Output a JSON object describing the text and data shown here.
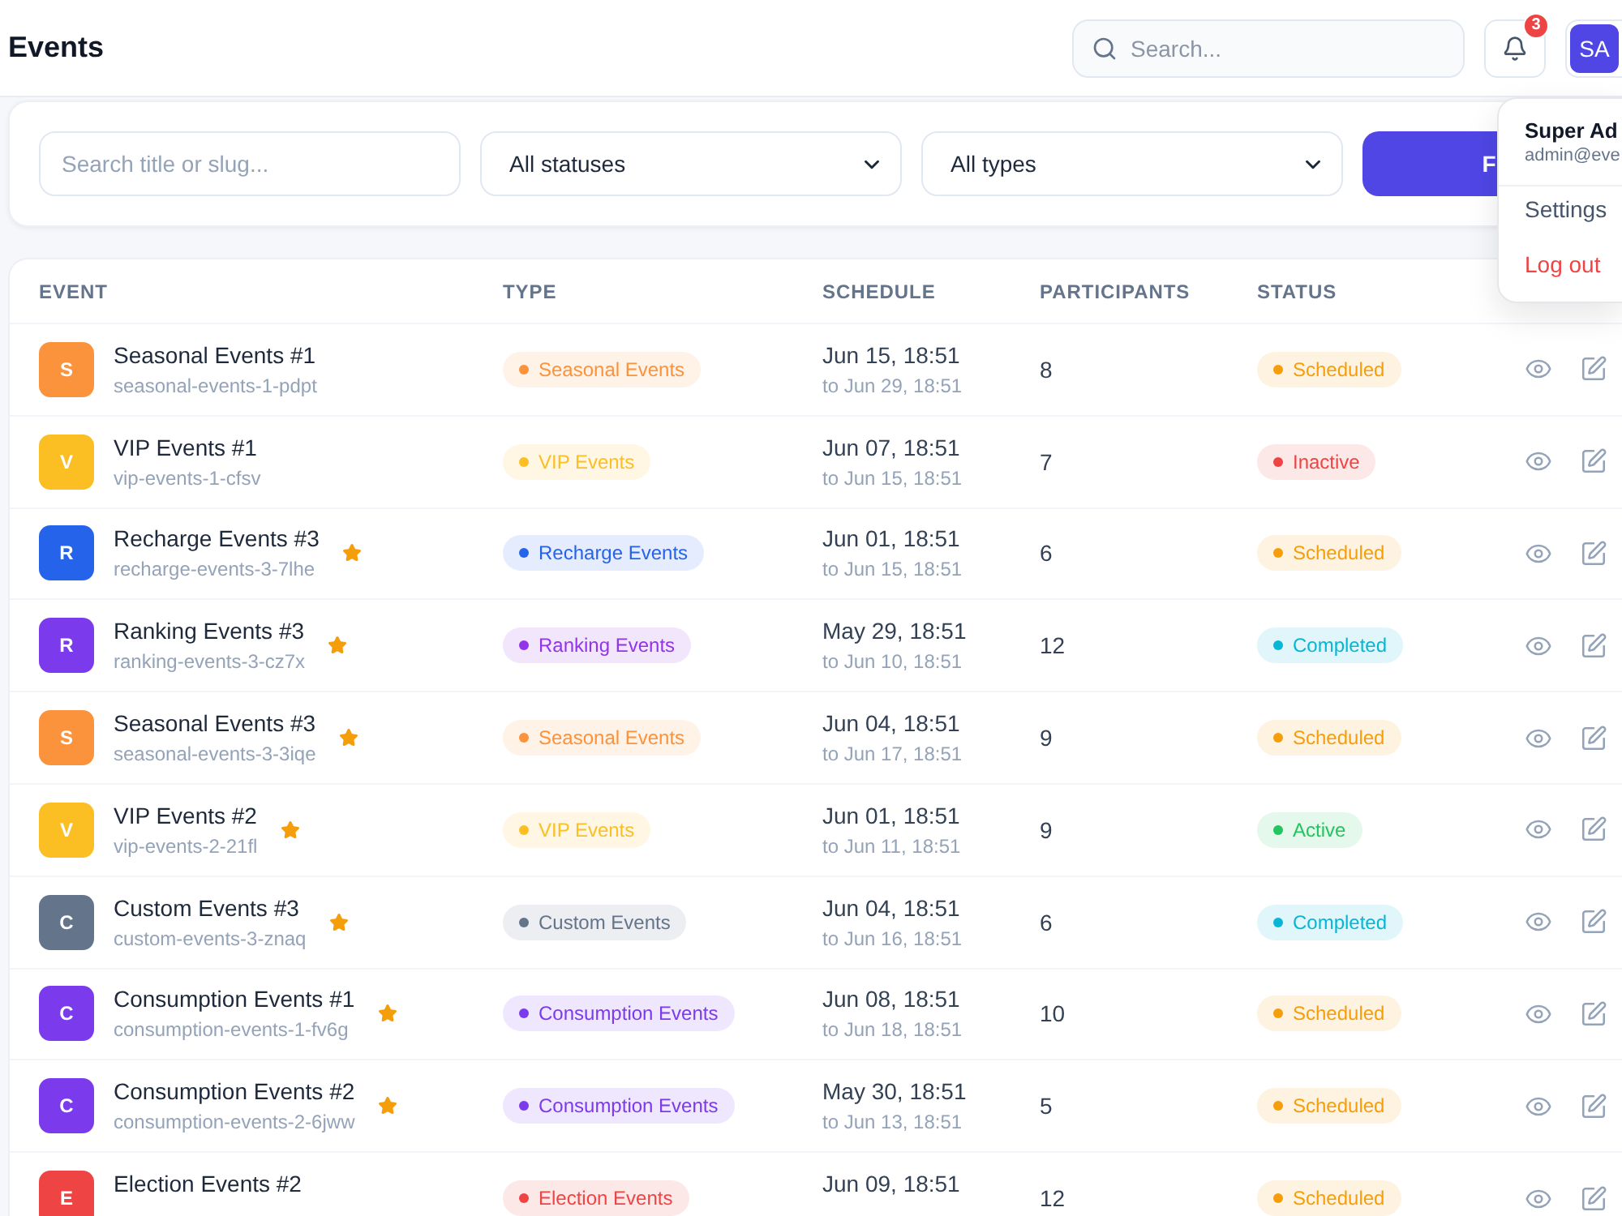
{
  "header": {
    "title": "Events",
    "search": {
      "placeholder": "Search..."
    },
    "notifications": {
      "count": "3"
    },
    "user": {
      "initials": "SA"
    }
  },
  "user_menu": {
    "name": "Super Ad",
    "email": "admin@eve",
    "items": [
      {
        "label": "Settings",
        "kind": "link"
      },
      {
        "label": "Log out",
        "kind": "danger"
      }
    ]
  },
  "filters": {
    "search": {
      "placeholder": "Search title or slug..."
    },
    "status_select": {
      "value": "All statuses"
    },
    "type_select": {
      "value": "All types"
    },
    "submit": {
      "label": "F"
    }
  },
  "table": {
    "columns": [
      "EVENT",
      "TYPE",
      "SCHEDULE",
      "PARTICIPANTS",
      "STATUS"
    ],
    "rows": [
      {
        "avatar": {
          "letter": "S",
          "color": "#fb923c"
        },
        "title": "Seasonal Events #1",
        "slug": "seasonal-events-1-pdpt",
        "featured": false,
        "type": {
          "label": "Seasonal Events",
          "color": "#fb923c"
        },
        "start": "Jun 15, 18:51",
        "end": "to Jun 29, 18:51",
        "participants": "8",
        "status": {
          "label": "Scheduled",
          "color": "#f59e0b"
        }
      },
      {
        "avatar": {
          "letter": "V",
          "color": "#fbbf24"
        },
        "title": "VIP Events #1",
        "slug": "vip-events-1-cfsv",
        "featured": false,
        "type": {
          "label": "VIP Events",
          "color": "#fbbf24"
        },
        "start": "Jun 07, 18:51",
        "end": "to Jun 15, 18:51",
        "participants": "7",
        "status": {
          "label": "Inactive",
          "color": "#ef4444"
        }
      },
      {
        "avatar": {
          "letter": "R",
          "color": "#2563eb"
        },
        "title": "Recharge Events #3",
        "slug": "recharge-events-3-7lhe",
        "featured": true,
        "type": {
          "label": "Recharge Events",
          "color": "#2563eb"
        },
        "start": "Jun 01, 18:51",
        "end": "to Jun 15, 18:51",
        "participants": "6",
        "status": {
          "label": "Scheduled",
          "color": "#f59e0b"
        }
      },
      {
        "avatar": {
          "letter": "R",
          "color": "#7c3aed"
        },
        "title": "Ranking Events #3",
        "slug": "ranking-events-3-cz7x",
        "featured": true,
        "type": {
          "label": "Ranking Events",
          "color": "#9333ea"
        },
        "start": "May 29, 18:51",
        "end": "to Jun 10, 18:51",
        "participants": "12",
        "status": {
          "label": "Completed",
          "color": "#06b6d4"
        }
      },
      {
        "avatar": {
          "letter": "S",
          "color": "#fb923c"
        },
        "title": "Seasonal Events #3",
        "slug": "seasonal-events-3-3iqe",
        "featured": true,
        "type": {
          "label": "Seasonal Events",
          "color": "#fb923c"
        },
        "start": "Jun 04, 18:51",
        "end": "to Jun 17, 18:51",
        "participants": "9",
        "status": {
          "label": "Scheduled",
          "color": "#f59e0b"
        }
      },
      {
        "avatar": {
          "letter": "V",
          "color": "#fbbf24"
        },
        "title": "VIP Events #2",
        "slug": "vip-events-2-21fl",
        "featured": true,
        "type": {
          "label": "VIP Events",
          "color": "#fbbf24"
        },
        "start": "Jun 01, 18:51",
        "end": "to Jun 11, 18:51",
        "participants": "9",
        "status": {
          "label": "Active",
          "color": "#22c55e"
        }
      },
      {
        "avatar": {
          "letter": "C",
          "color": "#64748b"
        },
        "title": "Custom Events #3",
        "slug": "custom-events-3-znaq",
        "featured": true,
        "type": {
          "label": "Custom Events",
          "color": "#64748b"
        },
        "start": "Jun 04, 18:51",
        "end": "to Jun 16, 18:51",
        "participants": "6",
        "status": {
          "label": "Completed",
          "color": "#06b6d4"
        }
      },
      {
        "avatar": {
          "letter": "C",
          "color": "#7c3aed"
        },
        "title": "Consumption Events #1",
        "slug": "consumption-events-1-fv6g",
        "featured": true,
        "type": {
          "label": "Consumption Events",
          "color": "#7c3aed"
        },
        "start": "Jun 08, 18:51",
        "end": "to Jun 18, 18:51",
        "participants": "10",
        "status": {
          "label": "Scheduled",
          "color": "#f59e0b"
        }
      },
      {
        "avatar": {
          "letter": "C",
          "color": "#7c3aed"
        },
        "title": "Consumption Events #2",
        "slug": "consumption-events-2-6jww",
        "featured": true,
        "type": {
          "label": "Consumption Events",
          "color": "#7c3aed"
        },
        "start": "May 30, 18:51",
        "end": "to Jun 13, 18:51",
        "participants": "5",
        "status": {
          "label": "Scheduled",
          "color": "#f59e0b"
        }
      },
      {
        "avatar": {
          "letter": "E",
          "color": "#ef4444"
        },
        "title": "Election Events #2",
        "featured": false,
        "type": {
          "label": "Election Events",
          "color": "#ef4444"
        },
        "start": "Jun 09, 18:51",
        "participants": "12",
        "status": {
          "label": "Scheduled",
          "color": "#f59e0b"
        }
      }
    ]
  }
}
